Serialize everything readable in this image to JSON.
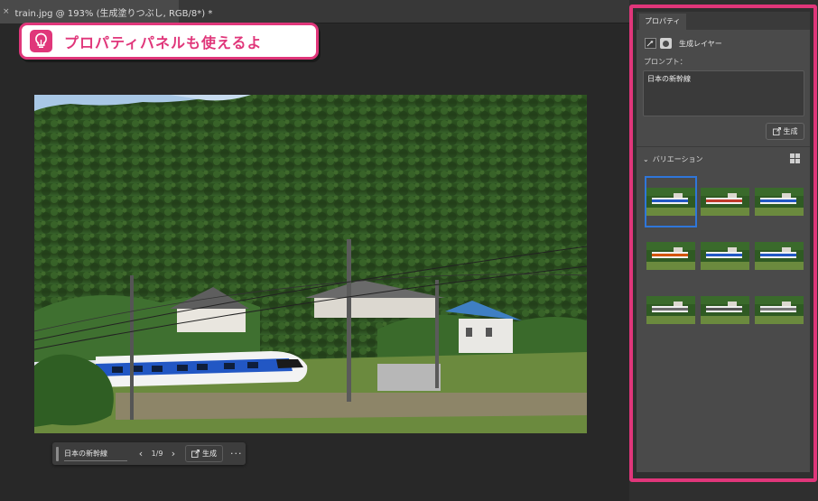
{
  "document_tab": {
    "close_glyph": "×",
    "title": "train.jpg @ 193% (生成塗りつぶし, RGB/8*) *"
  },
  "callout": {
    "text": "プロパティパネルも使えるよ",
    "icon": "lightbulb-icon",
    "accent_color": "#e0367a"
  },
  "contextual_bar": {
    "prompt": "日本の新幹線",
    "prev_glyph": "‹",
    "next_glyph": "›",
    "counter": "1/9",
    "generate_label": "生成",
    "more_glyph": "···"
  },
  "properties_panel": {
    "tab_label": "プロパティ",
    "layer_type_label": "生成レイヤー",
    "prompt_label": "プロンプト：",
    "prompt_value": "日本の新幹線",
    "generate_label": "生成",
    "variations_label": "バリエーション",
    "variations_chevron": "⌄",
    "selected_variation": 1,
    "variation_count": 9
  },
  "colors": {
    "highlight": "#e0367a",
    "selection": "#2f76d9"
  }
}
